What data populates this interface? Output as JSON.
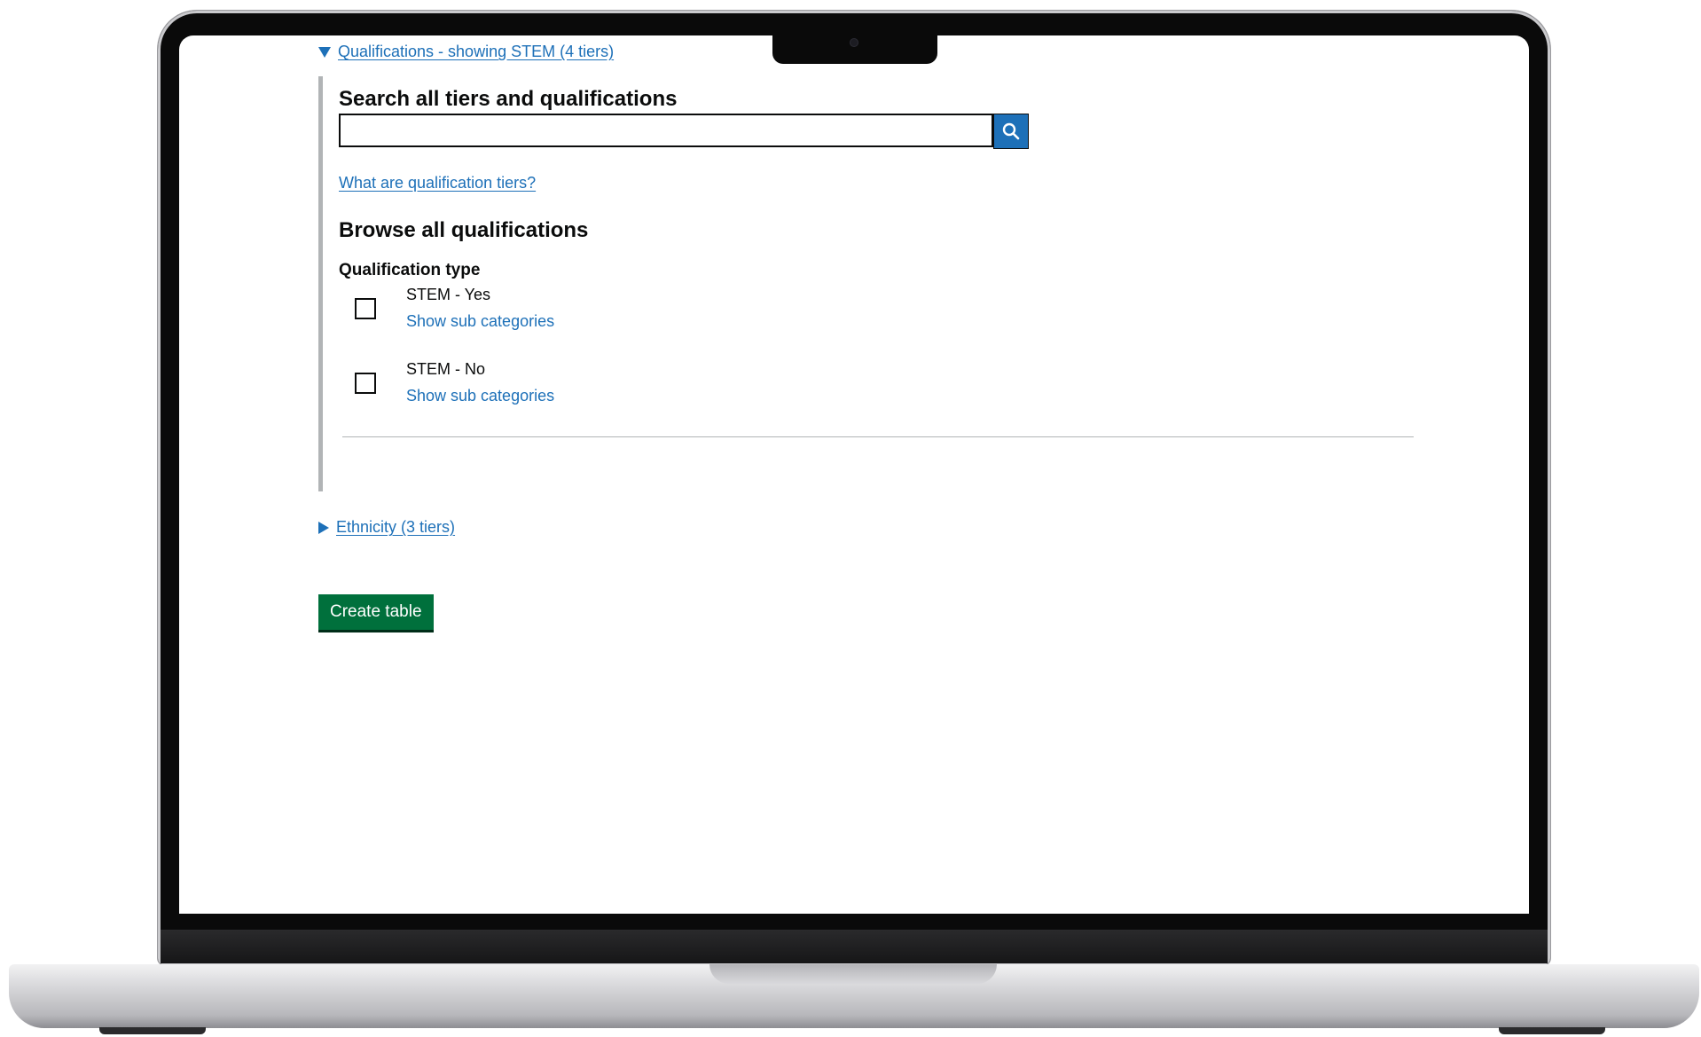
{
  "qualifications_summary": {
    "label": "Qualifications - showing STEM (4 tiers)"
  },
  "search": {
    "heading": "Search all tiers and qualifications",
    "value": "",
    "placeholder": "",
    "help_link": "What are qualification tiers?"
  },
  "browse": {
    "heading": "Browse all qualifications",
    "group_label": "Qualification type",
    "options": [
      {
        "label": "STEM - Yes",
        "sub_link": "Show sub categories",
        "checked": false
      },
      {
        "label": "STEM - No",
        "sub_link": "Show sub categories",
        "checked": false
      }
    ]
  },
  "ethnicity_summary": {
    "label": "Ethnicity (3 tiers)"
  },
  "actions": {
    "create_table_label": "Create table"
  },
  "icons": {
    "search": "search-icon",
    "expanded": "triangle-down-icon",
    "collapsed": "triangle-right-icon"
  },
  "colors": {
    "link": "#1d70b8",
    "primary_button": "#00703c",
    "text": "#0b0c0c",
    "border": "#b1b4b6"
  }
}
